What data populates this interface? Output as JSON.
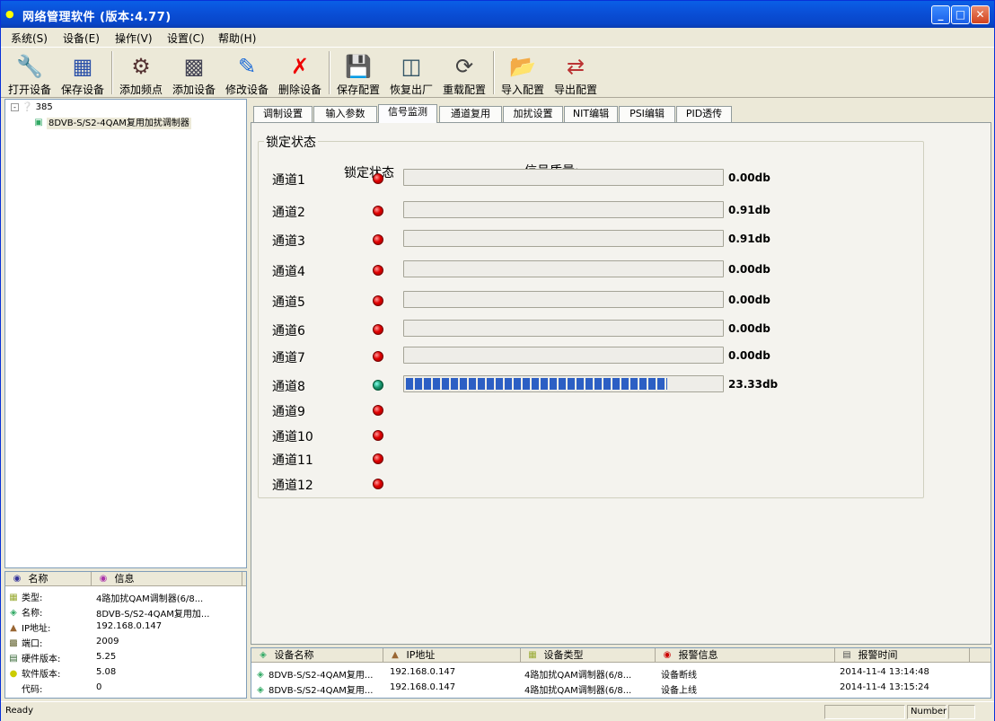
{
  "window": {
    "title": "网络管理软件 (版本:4.77)",
    "colors": {
      "titlebar": "#0a50d8",
      "progress": "#2c5fc4",
      "led_off": "#e00000",
      "led_on": "#1a9a70"
    }
  },
  "menu": [
    {
      "label": "系统(S)"
    },
    {
      "label": "设备(E)"
    },
    {
      "label": "操作(V)"
    },
    {
      "label": "设置(C)"
    },
    {
      "label": "帮助(H)"
    }
  ],
  "toolbar": [
    {
      "label": "打开设备",
      "icon": "wrench-icon"
    },
    {
      "label": "保存设备",
      "icon": "save-device-icon"
    },
    {
      "label": "添加频点",
      "icon": "frequency-icon"
    },
    {
      "label": "添加设备",
      "icon": "add-device-icon"
    },
    {
      "label": "修改设备",
      "icon": "edit-device-icon"
    },
    {
      "label": "删除设备",
      "icon": "delete-icon"
    },
    {
      "label": "保存配置",
      "icon": "floppy-icon"
    },
    {
      "label": "恢复出厂",
      "icon": "factory-reset-icon"
    },
    {
      "label": "重载配置",
      "icon": "reload-icon"
    },
    {
      "label": "导入配置",
      "icon": "import-icon"
    },
    {
      "label": "导出配置",
      "icon": "export-icon"
    }
  ],
  "tree": {
    "root_label": "385",
    "child_label": "8DVB-S/S2-4QAM复用加扰调制器"
  },
  "properties": {
    "headers": [
      "名称",
      "信息"
    ],
    "rows": [
      {
        "name": "类型:",
        "value": "4路加扰QAM调制器(6/8..."
      },
      {
        "name": "名称:",
        "value": "8DVB-S/S2-4QAM复用加..."
      },
      {
        "name": "IP地址:",
        "value": "192.168.0.147"
      },
      {
        "name": "端口:",
        "value": "2009"
      },
      {
        "name": "硬件版本:",
        "value": "5.25"
      },
      {
        "name": "软件版本:",
        "value": "5.08"
      },
      {
        "name": "代码:",
        "value": "0"
      }
    ]
  },
  "tabs": [
    {
      "label": "调制设置"
    },
    {
      "label": "输入参数"
    },
    {
      "label": "信号监测",
      "active": true
    },
    {
      "label": "通道复用"
    },
    {
      "label": "加扰设置"
    },
    {
      "label": "NIT编辑"
    },
    {
      "label": "PSI编辑"
    },
    {
      "label": "PID透传"
    }
  ],
  "monitor": {
    "group_title": "锁定状态",
    "lock_header": "锁定状态",
    "quality_header": "信号质量:",
    "channels": [
      {
        "name": "通道1",
        "locked": false,
        "quality": "0.00db",
        "level": 0,
        "has_bar": true
      },
      {
        "name": "通道2",
        "locked": false,
        "quality": "0.91db",
        "level": 0,
        "has_bar": true
      },
      {
        "name": "通道3",
        "locked": false,
        "quality": "0.91db",
        "level": 0,
        "has_bar": true
      },
      {
        "name": "通道4",
        "locked": false,
        "quality": "0.00db",
        "level": 0,
        "has_bar": true
      },
      {
        "name": "通道5",
        "locked": false,
        "quality": "0.00db",
        "level": 0,
        "has_bar": true
      },
      {
        "name": "通道6",
        "locked": false,
        "quality": "0.00db",
        "level": 0,
        "has_bar": true
      },
      {
        "name": "通道7",
        "locked": false,
        "quality": "0.00db",
        "level": 0,
        "has_bar": true
      },
      {
        "name": "通道8",
        "locked": true,
        "quality": "23.33db",
        "level": 0.83,
        "has_bar": true
      },
      {
        "name": "通道9",
        "locked": false,
        "has_bar": false
      },
      {
        "name": "通道10",
        "locked": false,
        "has_bar": false
      },
      {
        "name": "通道11",
        "locked": false,
        "has_bar": false
      },
      {
        "name": "通道12",
        "locked": false,
        "has_bar": false
      }
    ]
  },
  "alarms": {
    "headers": [
      "设备名称",
      "IP地址",
      "设备类型",
      "报警信息",
      "报警时间"
    ],
    "rows": [
      {
        "device": "8DVB-S/S2-4QAM复用...",
        "ip": "192.168.0.147",
        "type": "4路加扰QAM调制器(6/8...",
        "info": "设备断线",
        "time": "2014-11-4 13:14:48"
      },
      {
        "device": "8DVB-S/S2-4QAM复用...",
        "ip": "192.168.0.147",
        "type": "4路加扰QAM调制器(6/8...",
        "info": "设备上线",
        "time": "2014-11-4 13:15:24"
      }
    ]
  },
  "status": {
    "text": "Ready",
    "number_label": "Number"
  }
}
